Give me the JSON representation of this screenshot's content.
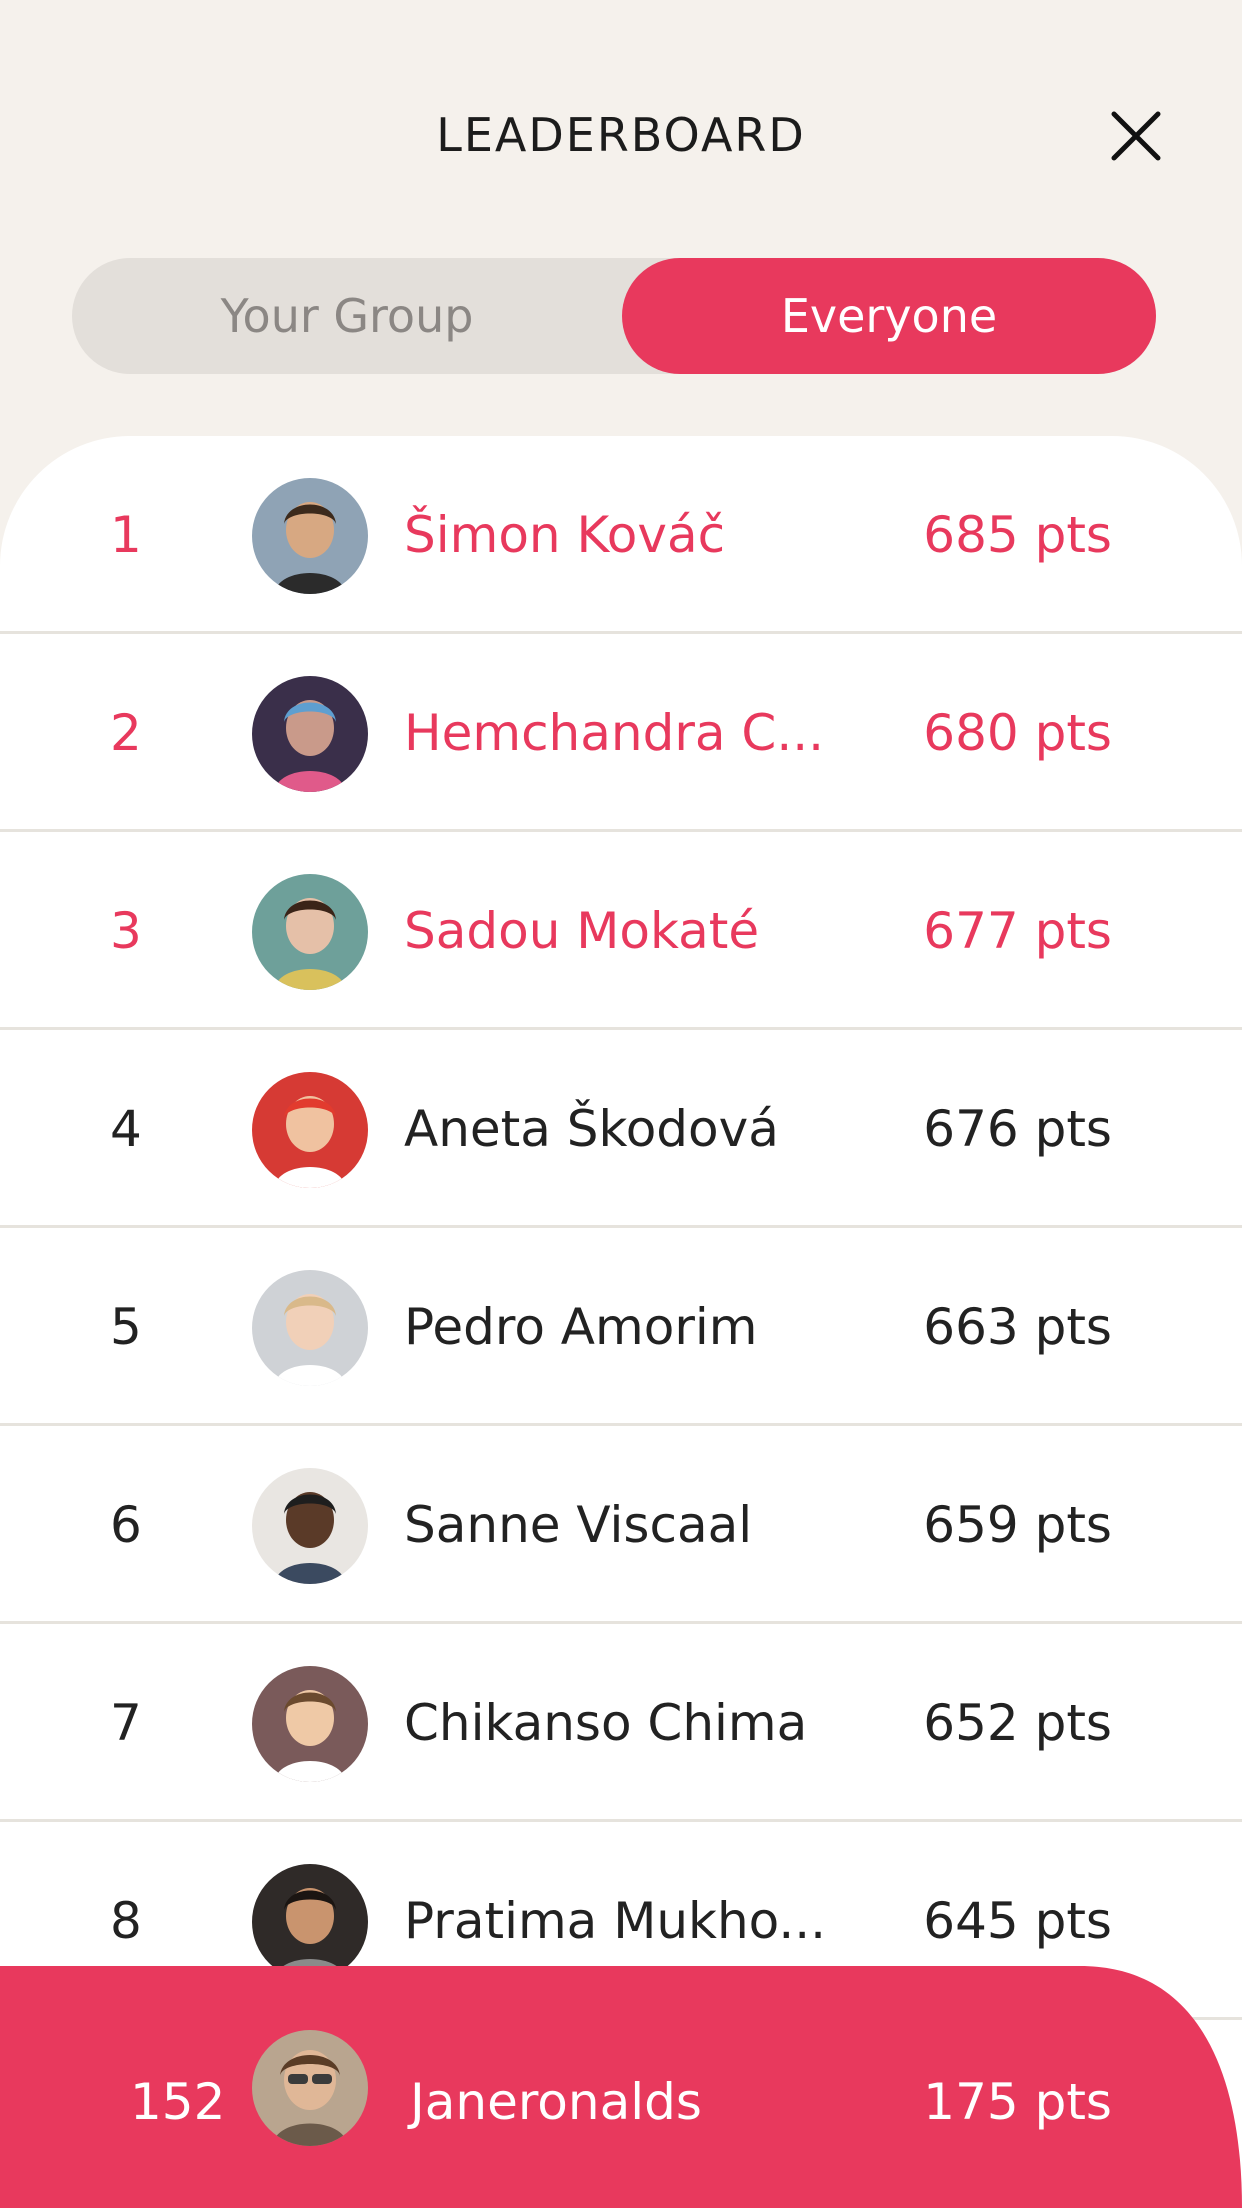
{
  "header": {
    "title": "LEADERBOARD"
  },
  "tabs": {
    "your_group": "Your Group",
    "everyone": "Everyone"
  },
  "colors": {
    "accent": "#e8395d",
    "background": "#f5f1ec",
    "tab_inactive": "#e3dfda"
  },
  "leaderboard": [
    {
      "rank": "1",
      "name": "Šimon Kováč",
      "points": "685 pts",
      "avatar": "avatar-photo"
    },
    {
      "rank": "2",
      "name": "Hemchandra C...",
      "points": "680 pts",
      "avatar": "avatar-photo"
    },
    {
      "rank": "3",
      "name": "Sadou Mokaté",
      "points": "677 pts",
      "avatar": "avatar-photo"
    },
    {
      "rank": "4",
      "name": "Aneta Škodová",
      "points": "676 pts",
      "avatar": "avatar-photo"
    },
    {
      "rank": "5",
      "name": "Pedro Amorim",
      "points": "663 pts",
      "avatar": "avatar-photo"
    },
    {
      "rank": "6",
      "name": "Sanne Viscaal",
      "points": "659 pts",
      "avatar": "avatar-photo"
    },
    {
      "rank": "7",
      "name": "Chikanso Chima",
      "points": "652 pts",
      "avatar": "avatar-photo"
    },
    {
      "rank": "8",
      "name": "Pratima Mukho...",
      "points": "645 pts",
      "avatar": "avatar-photo"
    }
  ],
  "current_user": {
    "rank": "152",
    "name": "Janeronalds",
    "points": "175 pts"
  }
}
